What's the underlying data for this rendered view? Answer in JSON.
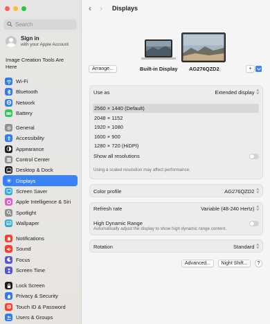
{
  "window": {
    "title": "Displays"
  },
  "sidebar": {
    "search_placeholder": "Search",
    "account": {
      "title": "Sign in",
      "subtitle": "with your Apple Account"
    },
    "tools_label": "Image Creation Tools Are Here",
    "items": [
      {
        "label": "Wi-Fi",
        "icon": "wifi-icon",
        "color": "#2f7bf5"
      },
      {
        "label": "Bluetooth",
        "icon": "bluetooth-icon",
        "color": "#2f7bf5"
      },
      {
        "label": "Network",
        "icon": "globe-icon",
        "color": "#2f7bf5"
      },
      {
        "label": "Battery",
        "icon": "battery-icon",
        "color": "#34c759"
      },
      {
        "label": "General",
        "icon": "gear-icon",
        "color": "#8e8e93"
      },
      {
        "label": "Accessibility",
        "icon": "accessibility-icon",
        "color": "#2f7bf5"
      },
      {
        "label": "Appearance",
        "icon": "appearance-icon",
        "color": "#1d1d1f"
      },
      {
        "label": "Control Center",
        "icon": "control-center-icon",
        "color": "#8e8e93"
      },
      {
        "label": "Desktop & Dock",
        "icon": "dock-icon",
        "color": "#1d1d1f"
      },
      {
        "label": "Displays",
        "icon": "sun-icon",
        "color": "#2f7bf5"
      },
      {
        "label": "Screen Saver",
        "icon": "screen-saver-icon",
        "color": "#34aadc"
      },
      {
        "label": "Apple Intelligence & Siri",
        "icon": "siri-icon",
        "color": "#e35cc3"
      },
      {
        "label": "Spotlight",
        "icon": "magnifier-icon",
        "color": "#8e8e93"
      },
      {
        "label": "Wallpaper",
        "icon": "wallpaper-icon",
        "color": "#34aadc"
      },
      {
        "label": "Notifications",
        "icon": "bell-icon",
        "color": "#ff3b30"
      },
      {
        "label": "Sound",
        "icon": "speaker-icon",
        "color": "#ff3b30"
      },
      {
        "label": "Focus",
        "icon": "moon-icon",
        "color": "#5856d6"
      },
      {
        "label": "Screen Time",
        "icon": "hourglass-icon",
        "color": "#5856d6"
      },
      {
        "label": "Lock Screen",
        "icon": "lock-icon",
        "color": "#1d1d1f"
      },
      {
        "label": "Privacy & Security",
        "icon": "hand-icon",
        "color": "#2f7bf5"
      },
      {
        "label": "Touch ID & Password",
        "icon": "fingerprint-icon",
        "color": "#ff3b30"
      },
      {
        "label": "Users & Groups",
        "icon": "users-icon",
        "color": "#2f7bf5"
      }
    ],
    "active_index": 9
  },
  "main": {
    "arrange_label": "Arrange...",
    "displays": [
      {
        "label": "Built-in Display"
      },
      {
        "label": "AG276QZD2"
      }
    ],
    "add_label": "+",
    "use_as": {
      "label": "Use as",
      "value": "Extended display"
    },
    "resolutions": [
      "2560 × 1440 (Default)",
      "2048 × 1152",
      "1920 × 1080",
      "1600 × 900",
      "1280 × 720 (HiDPI)"
    ],
    "selected_resolution_index": 0,
    "show_all_label": "Show all resolutions",
    "scaled_note": "Using a scaled resolution may affect performance.",
    "color_profile": {
      "label": "Color profile",
      "value": "AG276QZD2"
    },
    "refresh_rate": {
      "label": "Refresh rate",
      "value": "Variable (48-240 Hertz)"
    },
    "hdr": {
      "label": "High Dynamic Range",
      "note": "Automatically adjust the display to show high dynamic range content."
    },
    "rotation": {
      "label": "Rotation",
      "value": "Standard"
    },
    "advanced_label": "Advanced...",
    "night_shift_label": "Night Shift...",
    "help_label": "?"
  }
}
